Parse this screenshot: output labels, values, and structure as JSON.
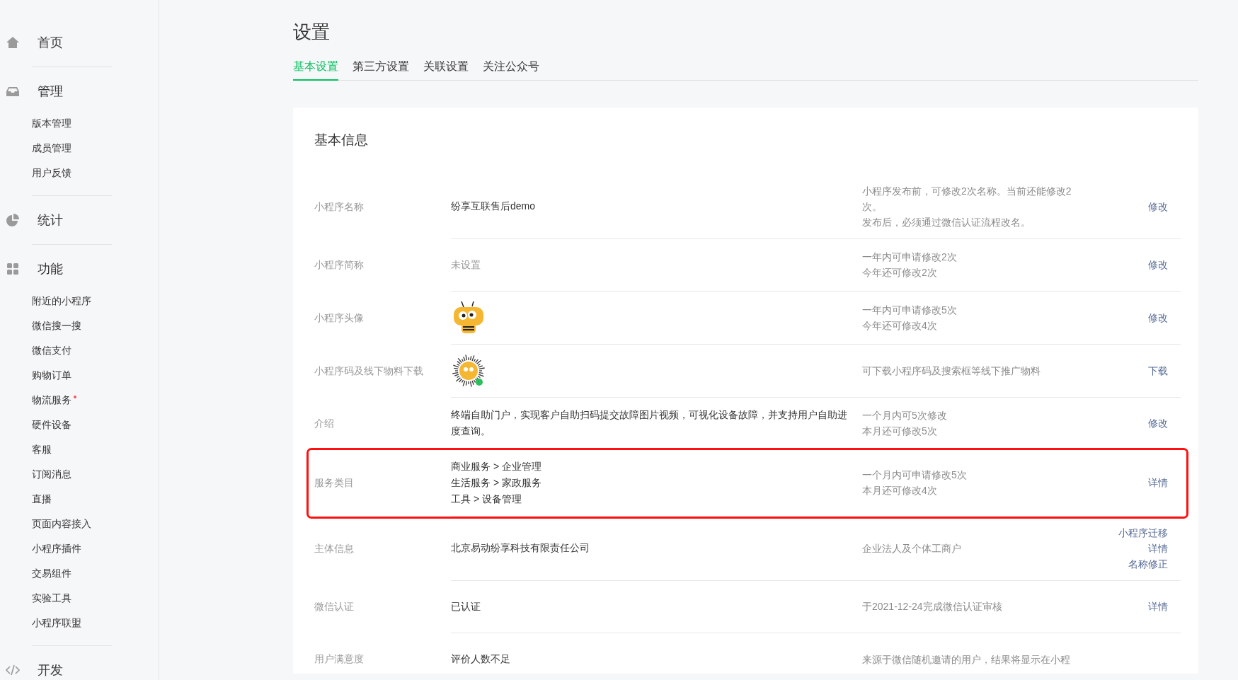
{
  "sidebar": [
    {
      "label": "首页"
    },
    {
      "label": "管理",
      "children": [
        {
          "label": "版本管理",
          "dot": false
        },
        {
          "label": "成员管理",
          "dot": false
        },
        {
          "label": "用户反馈",
          "dot": false
        }
      ]
    },
    {
      "label": "统计"
    },
    {
      "label": "功能",
      "children": [
        {
          "label": "附近的小程序",
          "dot": false
        },
        {
          "label": "微信搜一搜",
          "dot": false
        },
        {
          "label": "微信支付",
          "dot": false
        },
        {
          "label": "购物订单",
          "dot": false
        },
        {
          "label": "物流服务",
          "dot": true
        },
        {
          "label": "硬件设备",
          "dot": false
        },
        {
          "label": "客服",
          "dot": false
        },
        {
          "label": "订阅消息",
          "dot": false
        },
        {
          "label": "直播",
          "dot": false
        },
        {
          "label": "页面内容接入",
          "dot": false
        },
        {
          "label": "小程序插件",
          "dot": false
        },
        {
          "label": "交易组件",
          "dot": false
        },
        {
          "label": "实验工具",
          "dot": false
        },
        {
          "label": "小程序联盟",
          "dot": false
        }
      ]
    },
    {
      "label": "开发"
    }
  ],
  "page_title": "设置",
  "tabs": [
    {
      "label": "基本设置",
      "selected": true
    },
    {
      "label": "第三方设置",
      "selected": false
    },
    {
      "label": "关联设置",
      "selected": false
    },
    {
      "label": "关注公众号",
      "selected": false
    }
  ],
  "section_title": "基本信息",
  "rows": [
    {
      "label": "小程序名称",
      "kind": "text",
      "value": [
        "纷享互联售后demo"
      ],
      "note": [
        "小程序发布前，可修改2次名称。当前还能修改2次。",
        "发布后，必须通过微信认证流程改名。"
      ],
      "actions": [
        "修改"
      ],
      "highlighted": false
    },
    {
      "label": "小程序简称",
      "kind": "text",
      "value": [
        "未设置"
      ],
      "muted": true,
      "note": [
        "一年内可申请修改2次",
        "今年还可修改2次"
      ],
      "actions": [
        "修改"
      ],
      "highlighted": false
    },
    {
      "label": "小程序头像",
      "kind": "avatar",
      "note": [
        "一年内可申请修改5次",
        "今年还可修改4次"
      ],
      "actions": [
        "修改"
      ],
      "highlighted": false
    },
    {
      "label": "小程序码及线下物料下载",
      "kind": "qrcode",
      "note": [
        "可下载小程序码及搜索框等线下推广物料"
      ],
      "actions": [
        "下载"
      ],
      "highlighted": false
    },
    {
      "label": "介绍",
      "kind": "text",
      "value": [
        "终端自助门户，实现客户自助扫码提交故障图片视频，可视化设备故障，并支持用户自助进度查询。"
      ],
      "note": [
        "一个月内可5次修改",
        "本月还可修改5次"
      ],
      "actions": [
        "修改"
      ],
      "highlighted": false
    },
    {
      "label": "服务类目",
      "kind": "text",
      "value": [
        "商业服务 > 企业管理",
        "生活服务 > 家政服务",
        "工具 > 设备管理"
      ],
      "note": [
        "一个月内可申请修改5次",
        "本月还可修改4次"
      ],
      "actions": [
        "详情"
      ],
      "highlighted": true
    },
    {
      "label": "主体信息",
      "kind": "text",
      "value": [
        "北京易动纷享科技有限责任公司"
      ],
      "note": [
        "企业法人及个体工商户"
      ],
      "actions": [
        "小程序迁移",
        "详情",
        "名称修正"
      ],
      "highlighted": false
    },
    {
      "label": "微信认证",
      "kind": "text",
      "value": [
        "已认证"
      ],
      "note": [
        "于2021-12-24完成微信认证审核"
      ],
      "actions": [
        "详情"
      ],
      "highlighted": false
    },
    {
      "label": "用户满意度",
      "kind": "text",
      "value": [
        "评价人数不足"
      ],
      "note": [
        "来源于微信随机邀请的用户，结果将显示在小程"
      ],
      "actions": [],
      "highlighted": false
    }
  ]
}
